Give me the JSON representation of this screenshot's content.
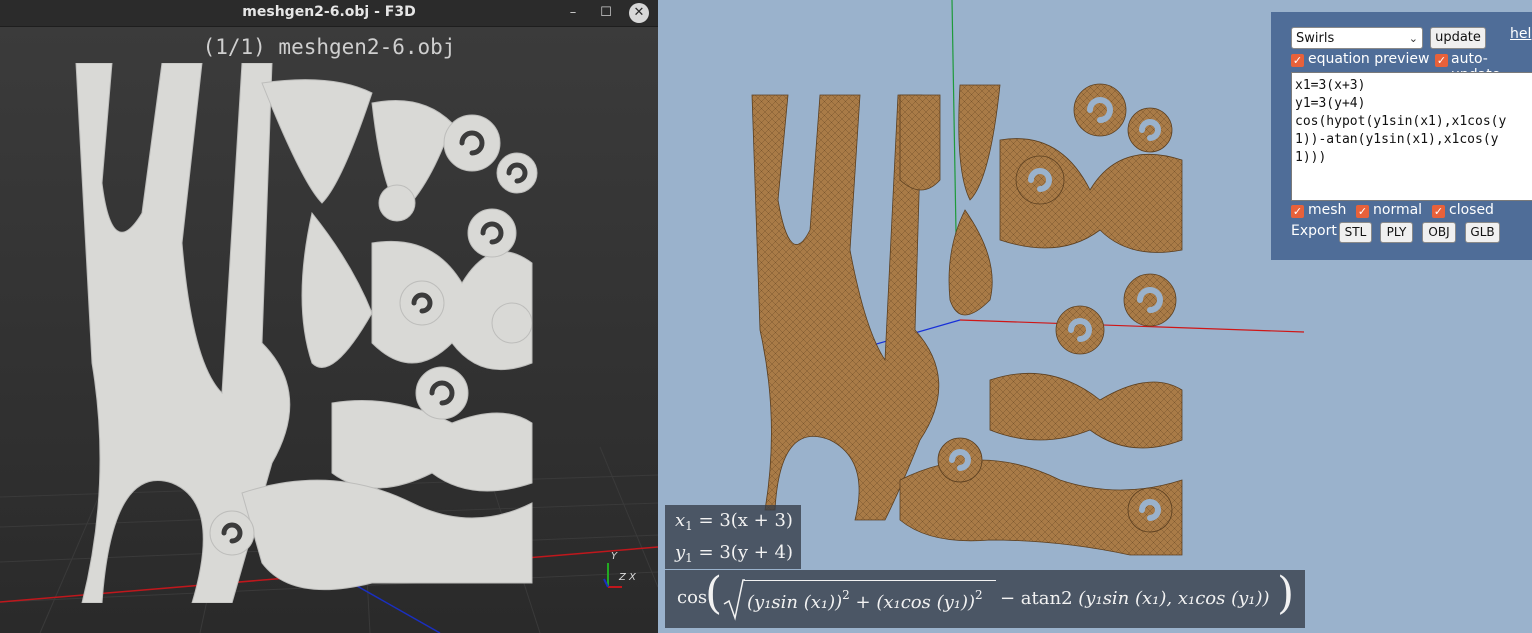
{
  "f3d": {
    "window_title": "meshgen2-6.obj - F3D",
    "controls": {
      "minimize": "–",
      "maximize": "☐",
      "close": "✕"
    },
    "header": "(1/1) meshgen2-6.obj",
    "axes": {
      "y": "Y",
      "z": "Z",
      "x": "X"
    },
    "colors": {
      "background": "#2f2f2f",
      "mesh": "#d9d9d6",
      "x_axis": "#c0171c",
      "z_axis": "#1a2fc0",
      "y_axis": "#22aa22"
    }
  },
  "viewer": {
    "preset": "Swirls",
    "update_label": "update",
    "help_label": "hel",
    "checks": {
      "equation_preview": {
        "label": "equation preview",
        "checked": true
      },
      "auto_update": {
        "label": "auto-update",
        "checked": true
      },
      "mesh": {
        "label": "mesh",
        "checked": true
      },
      "normal": {
        "label": "normal",
        "checked": true
      },
      "closed": {
        "label": "closed",
        "checked": true
      }
    },
    "equation_text": "x1=3(x+3)\ny1=3(y+4)\ncos(hypot(y1sin(x1),x1cos(y\n1))-atan(y1sin(x1),x1cos(y\n1)))",
    "export_label": "Export",
    "export_buttons": [
      "STL",
      "PLY",
      "OBJ",
      "GLB"
    ],
    "colors": {
      "background": "#9ab2cc",
      "panel": "#4f6d98",
      "mesh": "#a97b47",
      "checkbox": "#e8613a"
    },
    "rendered_equations": {
      "eq1_lhs": "x",
      "eq1_sub": "1",
      "eq1_rhs": " = 3(x + 3)",
      "eq2_lhs": "y",
      "eq2_sub": "1",
      "eq2_rhs": " = 3(y + 4)",
      "eq3": {
        "cos": "cos",
        "term1": "(y₁sin (x₁))",
        "plus": " + ",
        "term2": "(x₁cos (y₁))",
        "sq": "2",
        "minus": " − atan2 ",
        "args": "(y₁sin (x₁), x₁cos (y₁))"
      }
    }
  }
}
